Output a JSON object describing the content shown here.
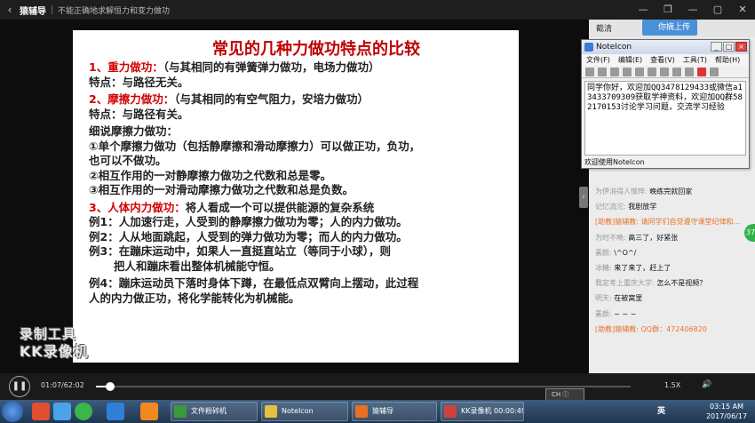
{
  "titlebar": {
    "back": "‹",
    "app_name": "猿辅导",
    "course": "不能正确地求解恒力和变力做功",
    "controls": [
      "—",
      "▢",
      "✕"
    ],
    "extra": [
      "—",
      "❐"
    ]
  },
  "slide": {
    "title": "常见的几种力做功特点的比较",
    "lines": [
      {
        "red": "1、重力做功：",
        "black": "（与其相同的有弹簧弹力做功，电场力做功）"
      },
      {
        "red": "",
        "black": "特点：与路径无关。"
      },
      {
        "red": "2、摩擦力做功：",
        "black": "（与其相同的有空气阻力，安培力做功）"
      },
      {
        "red": "",
        "black": "特点：与路径有关。"
      },
      {
        "red": "",
        "black": "细说摩擦力做功："
      },
      {
        "red": "",
        "black": "①单个摩擦力做功（包括静摩擦和滑动摩擦力）可以做正功，负功，"
      },
      {
        "red": "",
        "black": "也可以不做功。"
      },
      {
        "red": "",
        "black": "②相互作用的一对静摩擦力做功之代数和总是零。"
      },
      {
        "red": "",
        "black": "③相互作用的一对滑动摩擦力做功之代数和总是负数。"
      },
      {
        "red": "3、人体内力做功：",
        "black": "将人看成一个可以提供能源的复杂系统"
      },
      {
        "red": "",
        "black": "例1：人加速行走，人受到的静摩擦力做功为零；人的内力做功。"
      },
      {
        "red": "",
        "black": "例2：人从地面跳起，人受到的弹力做功为零；而人的内力做功。"
      },
      {
        "red": "",
        "black": "例3：在蹦床运动中，如果人一直挺直站立（等同于小球），则"
      },
      {
        "red": "",
        "black": "把人和蹦床看出整体机械能守恒。"
      },
      {
        "red": "",
        "black": "例4：蹦床运动员下落时身体下蹲，在最低点双臂向上摆动，此过程"
      },
      {
        "red": "",
        "black": "人的内力做正功，将化学能转化为机械能。"
      }
    ]
  },
  "watermark": {
    "line1": "录制工具",
    "line2": "KK录像机"
  },
  "rightpanel": {
    "clear_label": "截清",
    "upload_label": "你摘上传"
  },
  "note": {
    "title": "NoteIcon",
    "menu": [
      "文件(F)",
      "编辑(E)",
      "查看(V)",
      "工具(T)",
      "帮助(H)"
    ],
    "text": "同学你好，欢迎加QQ3478129433或微信a13433709309获取学神资料，欢迎加QQ群582170153讨论学习问题，交流学习经验",
    "status": "欢迎使用NoteIcon",
    "controls": [
      "_",
      "□",
      "×"
    ]
  },
  "chat": [
    {
      "name": "为伊消得人憔悴:",
      "msg": "晚练完就回家",
      "sys": false
    },
    {
      "name": "记忆流沱:",
      "msg": "我剧放学",
      "sys": false
    },
    {
      "name": "[助教]猿辅教:",
      "msg": "请同学们自觉遵守课堂纪律和...",
      "sys": true
    },
    {
      "name": "为时不晚:",
      "msg": "高三了，好紧张",
      "sys": false
    },
    {
      "name": "素颜:",
      "msg": "\\^O^/",
      "sys": false
    },
    {
      "name": "冰糖:",
      "msg": "来了来了，赶上了",
      "sys": false
    },
    {
      "name": "我定考上重庆大学:",
      "msg": "怎么不是视频？",
      "sys": false
    },
    {
      "name": "明天:",
      "msg": "在被窝里",
      "sys": false
    },
    {
      "name": "素颜:",
      "msg": "~ ~ ~",
      "sys": false
    },
    {
      "name": "[助教]猿辅教:",
      "msg": "QQ群：472406820",
      "sys": true
    }
  ],
  "side_arrow": "‹",
  "side_badge": "37",
  "player": {
    "pause_icon": "❚❚",
    "time": "01:07/62:02",
    "progress": 0.027,
    "speed": "1.5X",
    "volume_icon": "🔊",
    "popup": "CH  ⓘ"
  },
  "taskbar": {
    "tasks": [
      {
        "label": "文件粉碎机",
        "color": "#3a9a3a"
      },
      {
        "label": "NoteIcon",
        "color": "#e8c040"
      },
      {
        "label": "猿辅导",
        "color": "#e87020"
      },
      {
        "label": "KK录像机 00:00:49",
        "color": "#d04040"
      }
    ],
    "ime": "英",
    "clock_time": "03:15 AM",
    "clock_date": "2017/06/17"
  },
  "colors": {
    "red": "#d40000",
    "title_red": "#c00000",
    "system_msg": "#e8732a"
  }
}
